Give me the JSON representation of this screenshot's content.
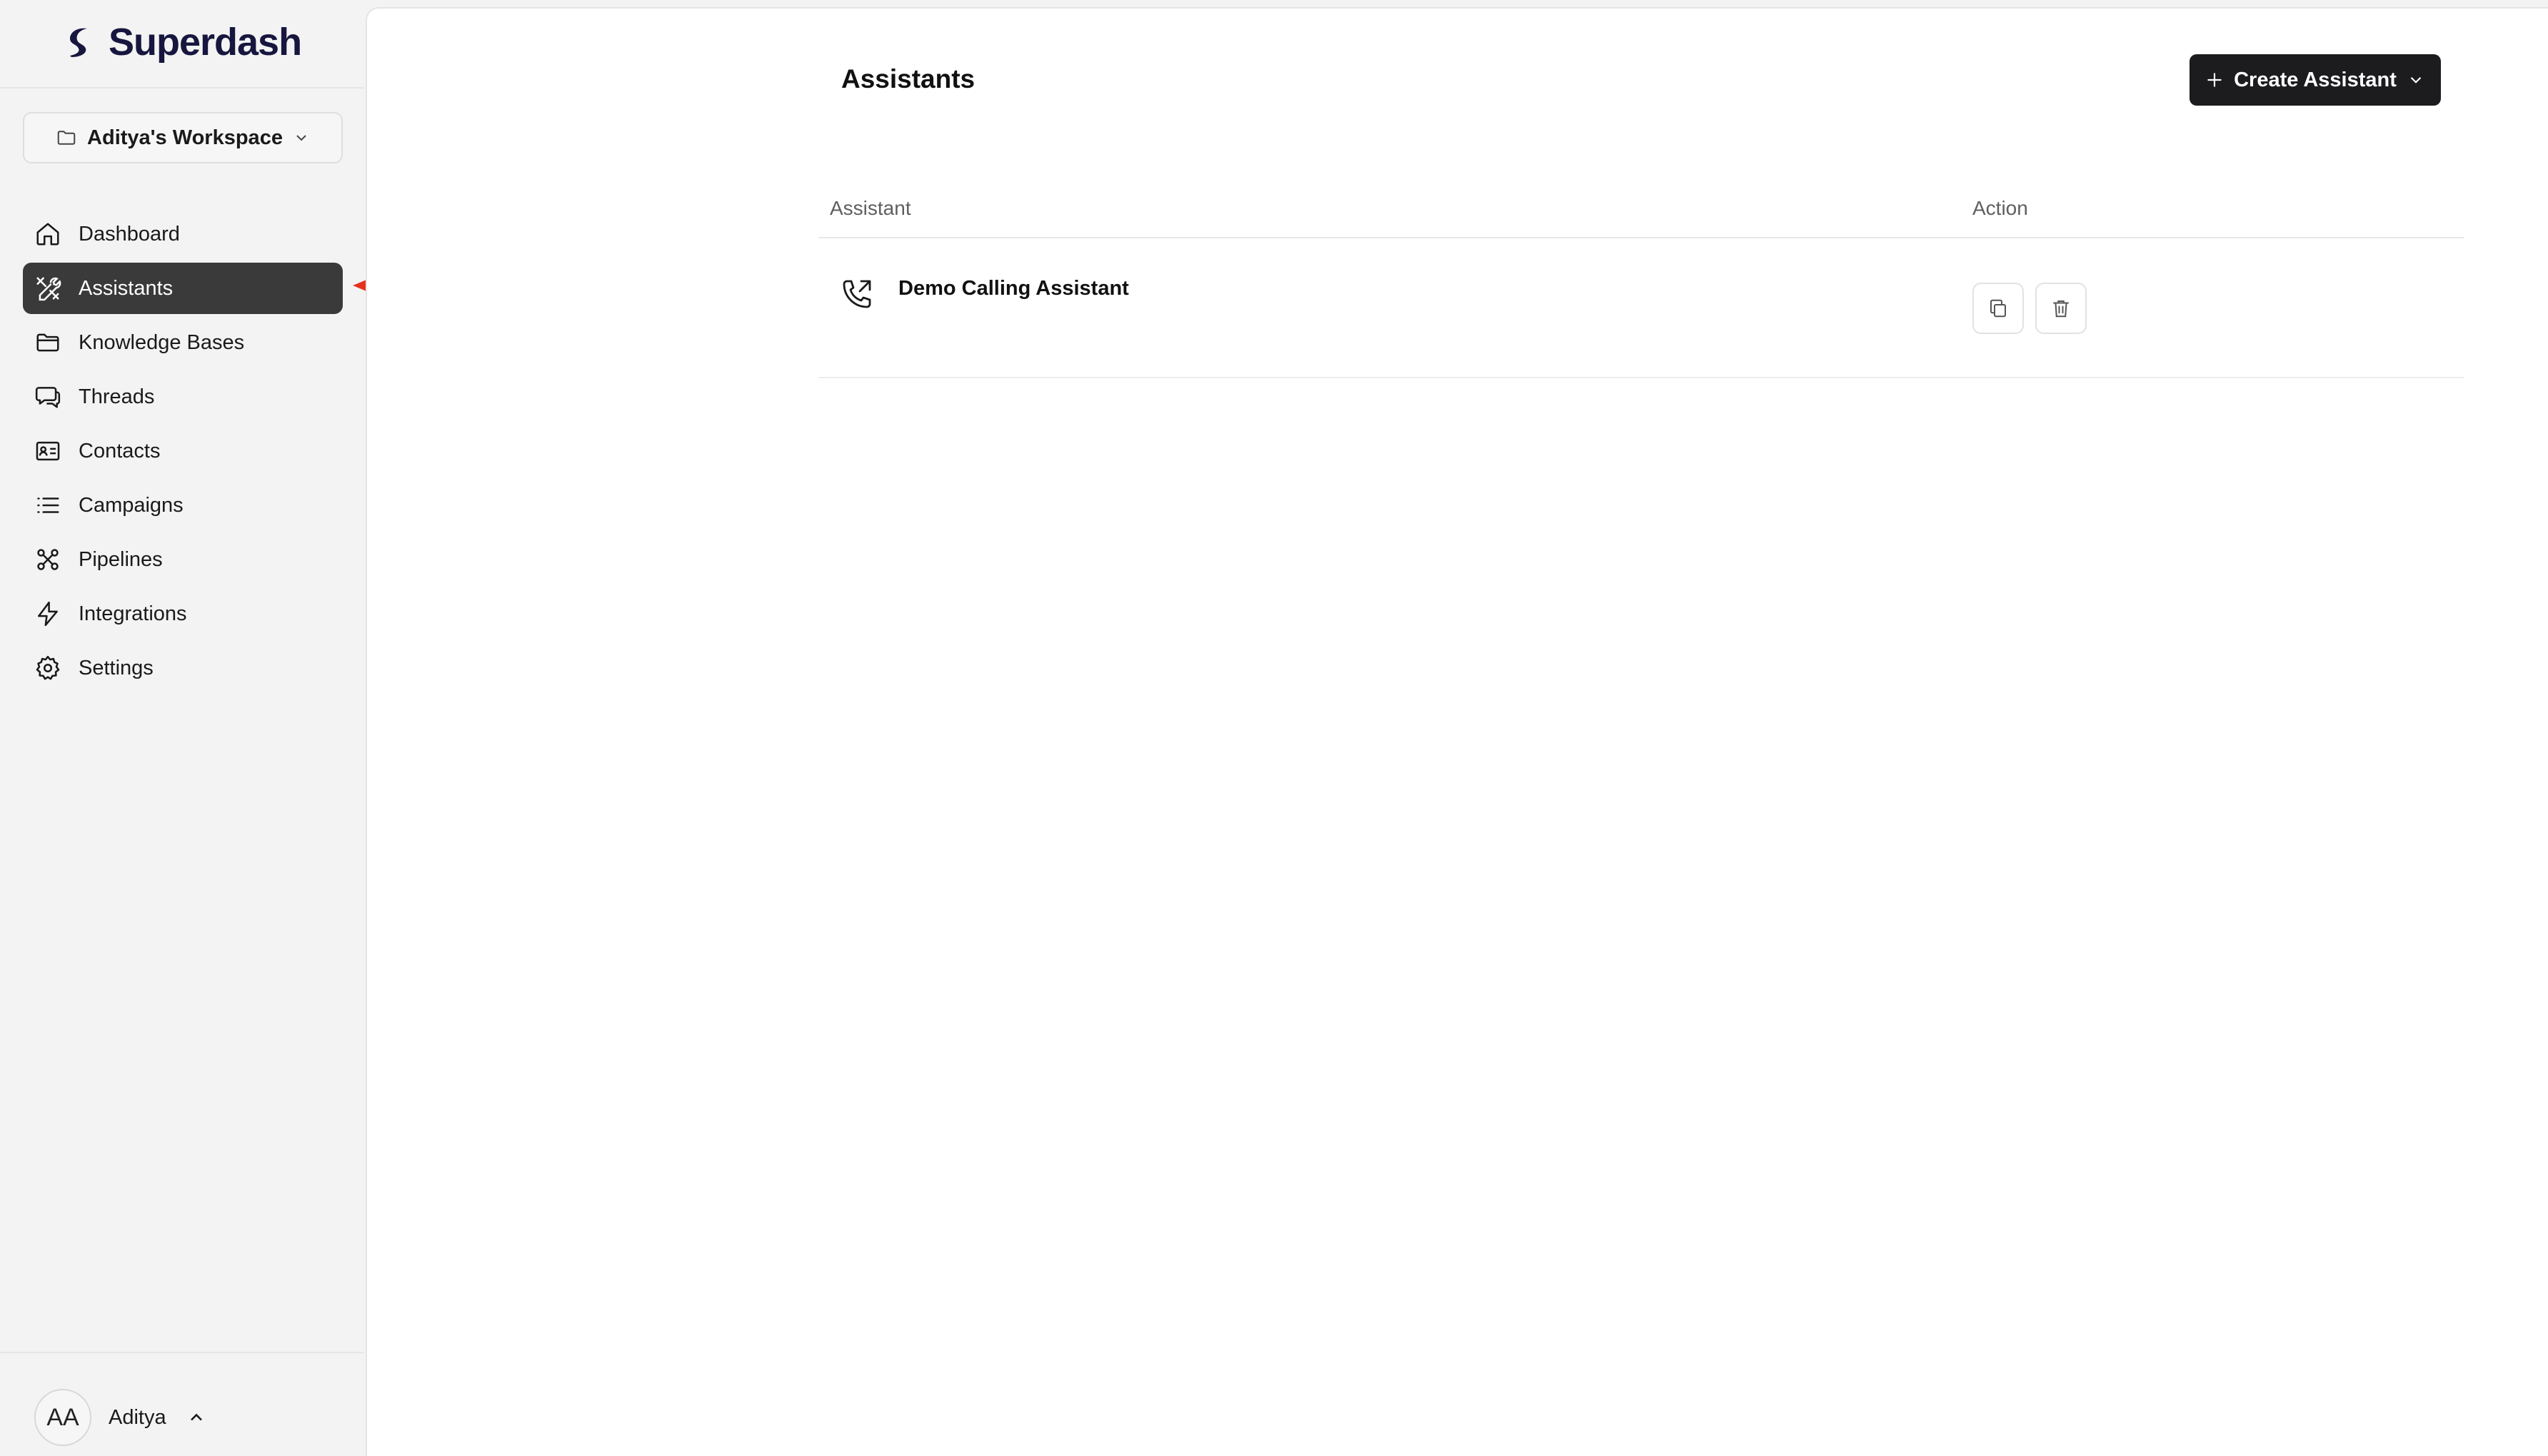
{
  "brand": {
    "name": "Superdash",
    "logo_icon": "superdash-logo-icon",
    "color": "#16163f"
  },
  "workspace": {
    "label": "Aditya's Workspace",
    "icon": "folder-icon"
  },
  "sidebar": {
    "items": [
      {
        "label": "Dashboard",
        "icon": "home-icon",
        "active": false
      },
      {
        "label": "Assistants",
        "icon": "tools-icon",
        "active": true
      },
      {
        "label": "Knowledge Bases",
        "icon": "folder-icon",
        "active": false
      },
      {
        "label": "Threads",
        "icon": "chat-bubbles-icon",
        "active": false
      },
      {
        "label": "Contacts",
        "icon": "contact-card-icon",
        "active": false
      },
      {
        "label": "Campaigns",
        "icon": "list-icon",
        "active": false
      },
      {
        "label": "Pipelines",
        "icon": "pipeline-icon",
        "active": false
      },
      {
        "label": "Integrations",
        "icon": "lightning-icon",
        "active": false
      },
      {
        "label": "Settings",
        "icon": "gear-icon",
        "active": false
      }
    ],
    "active_color": "#3a3a3a"
  },
  "user": {
    "initials": "AA",
    "name": "Aditya",
    "icon": "chevron-up-icon"
  },
  "main": {
    "title": "Assistants",
    "create_button": {
      "label": "Create Assistant",
      "icon": "plus-icon",
      "dropdown_icon": "chevron-down-icon",
      "color": "#1c1c1f"
    },
    "table": {
      "columns": [
        "Assistant",
        "Action"
      ],
      "rows": [
        {
          "name": "Demo Calling Assistant",
          "icon": "phone-outgoing-icon",
          "actions": [
            "copy-icon",
            "trash-icon"
          ]
        }
      ]
    }
  },
  "annotation": {
    "arrow_color": "#e5321e",
    "points_to": "Assistants"
  }
}
